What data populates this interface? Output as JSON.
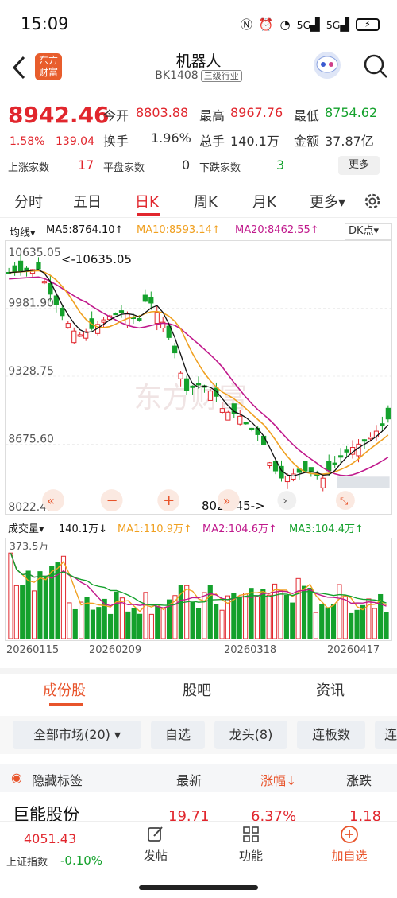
{
  "status_bar": {
    "time": "15:09",
    "signal1": "5G",
    "signal2": "5G"
  },
  "header": {
    "logo_text": "东方财富",
    "title": "机器人",
    "code": "BK1408",
    "tag": "三级行业"
  },
  "quote": {
    "price": "8942.46",
    "pct": "1.58%",
    "change": "139.04",
    "open_label": "今开",
    "open": "8803.88",
    "high_label": "最高",
    "high": "8967.76",
    "low_label": "最低",
    "low": "8754.62",
    "turnover_label": "换手",
    "turnover": "1.96%",
    "volume_label": "总手",
    "volume": "140.1万",
    "amount_label": "金额",
    "amount": "37.87亿",
    "up_label": "上涨家数",
    "up": "17",
    "flat_label": "平盘家数",
    "flat": "0",
    "down_label": "下跌家数",
    "down": "3",
    "more_label": "更多"
  },
  "tabs": [
    "分时",
    "五日",
    "日K",
    "周K",
    "月K",
    "更多▾"
  ],
  "active_tab": "日K",
  "ma_line": {
    "type": "均线▾",
    "ma5": "MA5:8764.10↑",
    "ma10": "MA10:8593.14↑",
    "ma20": "MA20:8462.55↑",
    "dk": "DK点▾"
  },
  "price_axis": [
    "10635.05",
    "9981.90",
    "9328.75",
    "8675.60",
    "8022.45"
  ],
  "chart_annotations": {
    "high_marker": "<-10635.05",
    "low_marker": "8022.45->"
  },
  "vol_line": {
    "label": "成交量▾",
    "total": "140.1万↓",
    "ma1": "MA1:110.9万↑",
    "ma2": "MA2:104.6万↑",
    "ma3": "MA3:104.4万↑"
  },
  "vol_axis_max": "373.5万",
  "dates": [
    "20260115",
    "20260209",
    "20260318",
    "20260417"
  ],
  "colors": {
    "up": "#e1262d",
    "down": "#14a12c",
    "ma5": "#111111",
    "ma10": "#f0a020",
    "ma20": "#c0198c",
    "accent": "#e8542b"
  },
  "sub_tabs": [
    "成份股",
    "股吧",
    "资讯"
  ],
  "filters": [
    "全部市场(20) ▾",
    "自选",
    "龙头(8)",
    "连板数",
    "连"
  ],
  "list_header": {
    "hide_tags": "隐藏标签",
    "latest": "最新",
    "change_pct": "涨幅↓",
    "change": "涨跌"
  },
  "first_row": {
    "name": "巨能股份",
    "latest": "19.71",
    "pct": "6.37%",
    "change": "1.18"
  },
  "bottom_bar": {
    "index_value": "4051.43",
    "index_name": "上证指数",
    "index_change": "-0.10%",
    "post": "发帖",
    "function": "功能",
    "add_fav": "加自选"
  }
}
